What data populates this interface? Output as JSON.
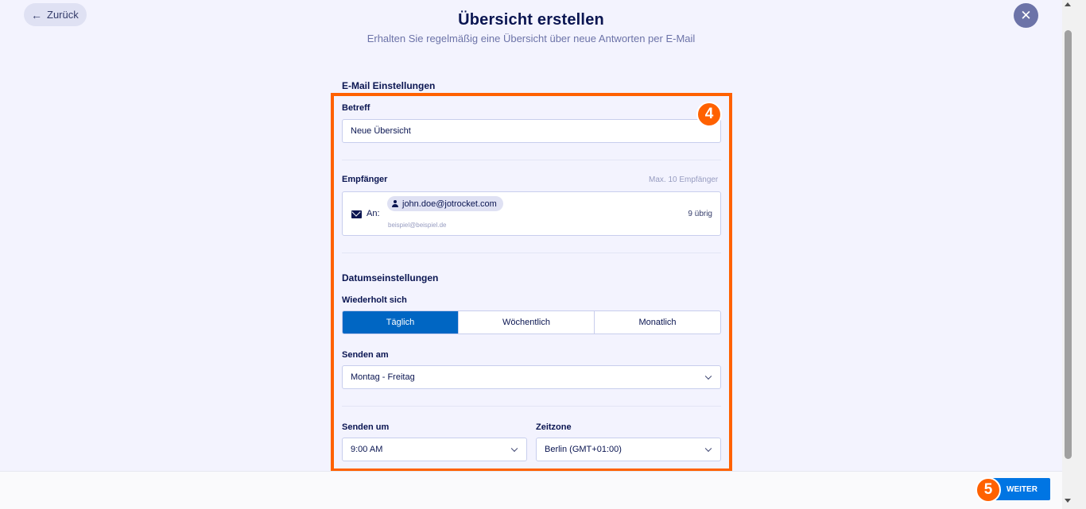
{
  "nav": {
    "back_label": "Zurück",
    "back_icon": "arrow-left-icon",
    "close_icon": "close-icon",
    "close_glyph": "✕"
  },
  "header": {
    "title": "Übersicht erstellen",
    "subtitle": "Erhalten Sie regelmäßig eine Übersicht über neue Antworten per E-Mail"
  },
  "email_settings": {
    "section_title": "E-Mail Einstellungen",
    "subject_label": "Betreff",
    "subject_value": "Neue Übersicht",
    "recipients_label": "Empfänger",
    "recipients_max": "Max. 10 Empfänger",
    "to_label": "An:",
    "recipients": [
      "john.doe@jotrocket.com"
    ],
    "recipient_placeholder": "beispiel@beispiel.de",
    "remaining": "9 übrig"
  },
  "date_settings": {
    "section_title": "Datumseinstellungen",
    "repeat_label": "Wiederholt sich",
    "repeat_options": [
      "Täglich",
      "Wöchentlich",
      "Monatlich"
    ],
    "repeat_selected": "Täglich",
    "send_on_label": "Senden am",
    "send_on_value": "Montag - Freitag",
    "send_at_label": "Senden um",
    "send_at_value": "9:00 AM",
    "timezone_label": "Zeitzone",
    "timezone_value": "Berlin (GMT+01:00)"
  },
  "footer": {
    "next_label": "WEITER"
  },
  "annotations": {
    "step_panel": "4",
    "step_next": "5",
    "highlight_color": "#ff6100"
  },
  "colors": {
    "primary": "#0066c3",
    "button": "#0075e3",
    "text": "#0a1551",
    "background": "#f3f3fe"
  }
}
